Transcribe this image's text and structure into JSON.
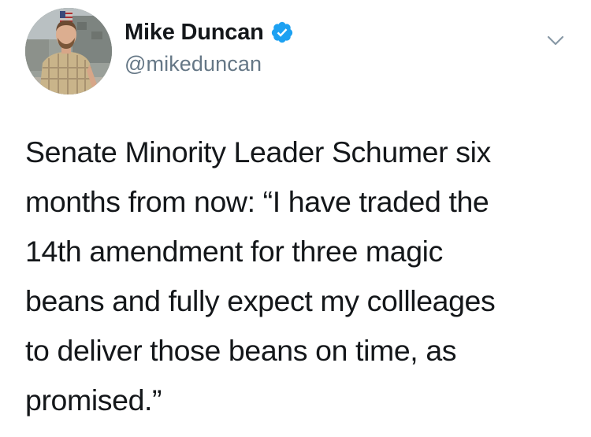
{
  "tweet": {
    "author": {
      "display_name": "Mike Duncan",
      "handle": "@mikeduncan",
      "verified": true,
      "verified_color": "#1da1f2"
    },
    "menu_icon": "chevron-down-icon",
    "text_lines": [
      "Senate Minority Leader Schumer six",
      "months from now: “I have traded the",
      "14th amendment for three magic",
      "beans and fully expect my collleages",
      "to deliver those beans on time, as",
      "promised.”"
    ],
    "colors": {
      "text": "#14171a",
      "secondary": "#657786",
      "accent": "#1da1f2",
      "background": "#ffffff"
    }
  }
}
